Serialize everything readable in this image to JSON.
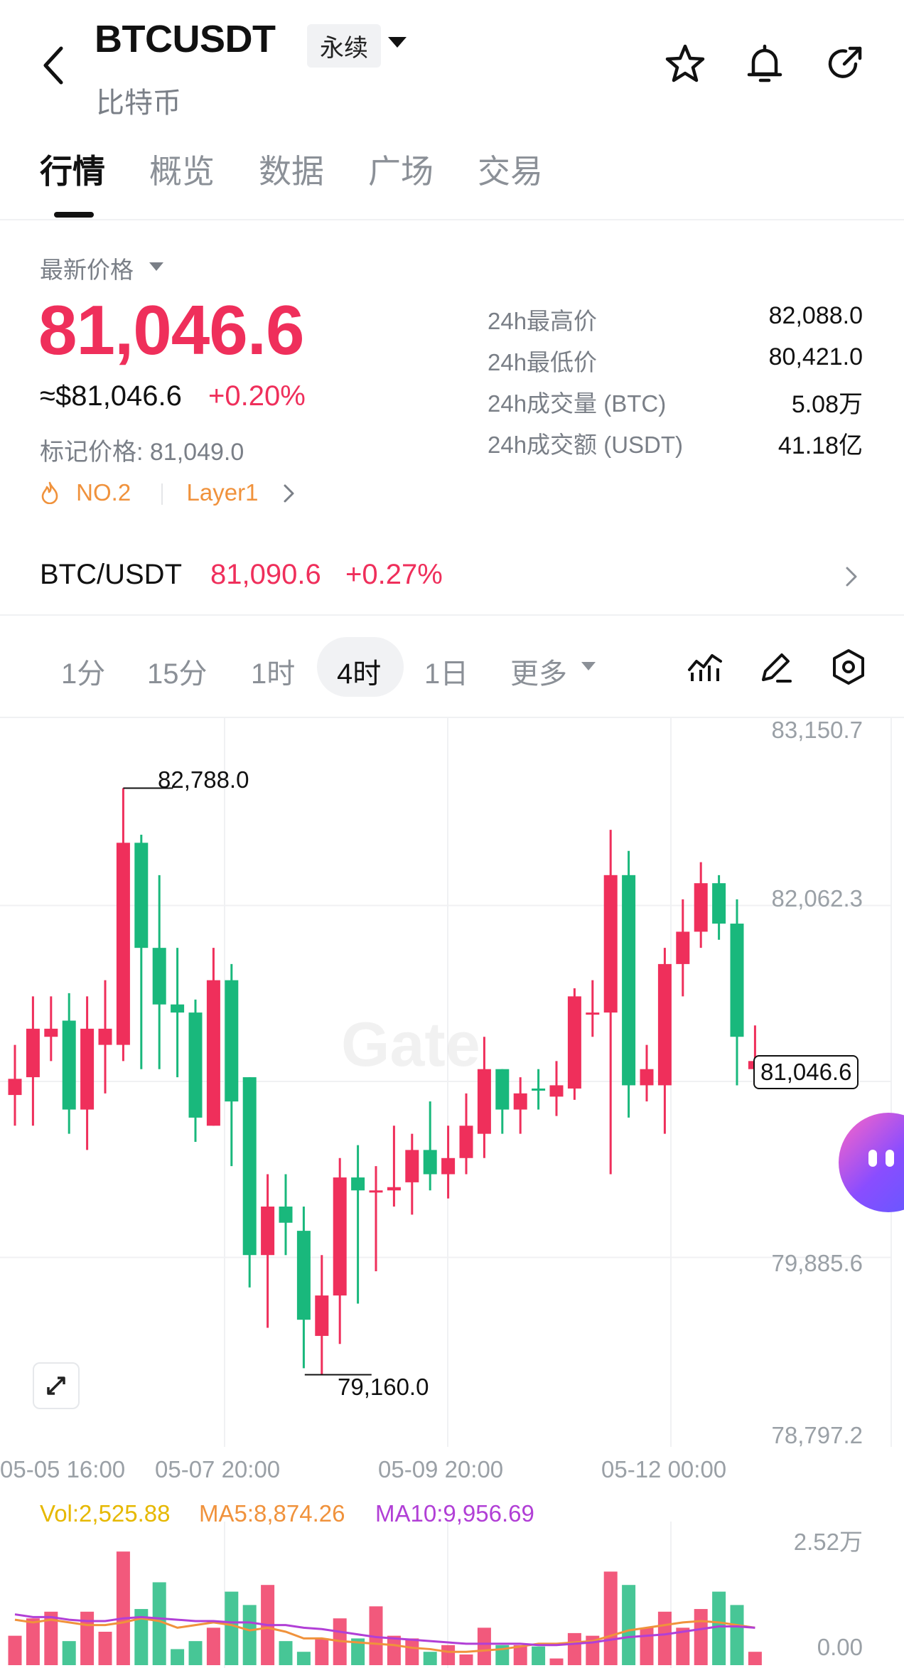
{
  "header": {
    "symbol": "BTCUSDT",
    "contract_type": "永续",
    "subtitle": "比特币"
  },
  "tabs": [
    "行情",
    "概览",
    "数据",
    "广场",
    "交易"
  ],
  "price": {
    "label": "最新价格",
    "last": "81,046.6",
    "usd": "≈$81,046.6",
    "change": "+0.20%",
    "mark": "标记价格: 81,049.0",
    "rank": "NO.2",
    "category": "Layer1"
  },
  "stats": [
    {
      "label": "24h最高价",
      "value": "82,088.0"
    },
    {
      "label": "24h最低价",
      "value": "80,421.0"
    },
    {
      "label": "24h成交量 (BTC)",
      "value": "5.08万"
    },
    {
      "label": "24h成交额 (USDT)",
      "value": "41.18亿"
    }
  ],
  "spot": {
    "pair": "BTC/USDT",
    "price": "81,090.6",
    "change": "+0.27%"
  },
  "timeframes": [
    "1分",
    "15分",
    "1时",
    "4时",
    "1日",
    "更多"
  ],
  "timeframe_active": "4时",
  "chart": {
    "y_axis": [
      "83,150.7",
      "82,062.3",
      "79,885.6",
      "78,797.2"
    ],
    "x_axis": [
      "05-05 16:00",
      "05-07 20:00",
      "05-09 20:00",
      "05-12 00:00"
    ],
    "high_label": "82,788.0",
    "low_label": "79,160.0",
    "current_price": "81,046.6",
    "watermark": "Gate",
    "colors": {
      "up": "#ef2f5b",
      "down": "#19b87c"
    }
  },
  "volume": {
    "vol": "Vol:2,525.88",
    "ma5": "MA5:8,874.26",
    "ma10": "MA10:9,956.69",
    "axis_top": "2.52万",
    "axis_bottom": "0.00",
    "colors": {
      "vol": "#e6b800",
      "ma5": "#f0923c",
      "ma10": "#b13fd6"
    }
  },
  "chart_data": {
    "type": "candlestick",
    "ylim": [
      78797.2,
      83150.7
    ],
    "candles": [
      [
        80890,
        80990,
        81200,
        80700,
        "up"
      ],
      [
        81000,
        81300,
        81500,
        80700,
        "up"
      ],
      [
        81300,
        81250,
        81500,
        81100,
        "up"
      ],
      [
        81350,
        80800,
        81520,
        80650,
        "down"
      ],
      [
        80800,
        81300,
        81500,
        80550,
        "up"
      ],
      [
        81300,
        81200,
        81600,
        80900,
        "up"
      ],
      [
        81200,
        82450,
        82788,
        81100,
        "up"
      ],
      [
        82450,
        81800,
        82500,
        81050,
        "down"
      ],
      [
        81800,
        81450,
        82250,
        81050,
        "down"
      ],
      [
        81450,
        81400,
        81800,
        81000,
        "down"
      ],
      [
        81400,
        80750,
        81480,
        80600,
        "down"
      ],
      [
        80700,
        81600,
        81800,
        80700,
        "up"
      ],
      [
        81600,
        80850,
        81700,
        80450,
        "down"
      ],
      [
        81000,
        79900,
        81000,
        79700,
        "down"
      ],
      [
        79900,
        80200,
        80400,
        79450,
        "up"
      ],
      [
        80200,
        80100,
        80400,
        79900,
        "down"
      ],
      [
        80050,
        79500,
        80200,
        79200,
        "down"
      ],
      [
        79400,
        79650,
        79900,
        79160,
        "up"
      ],
      [
        79650,
        80380,
        80500,
        79350,
        "up"
      ],
      [
        80380,
        80300,
        80580,
        79600,
        "down"
      ],
      [
        80290,
        80300,
        80450,
        79800,
        "up"
      ],
      [
        80300,
        80320,
        80700,
        80200,
        "up"
      ],
      [
        80350,
        80550,
        80650,
        80150,
        "up"
      ],
      [
        80550,
        80400,
        80850,
        80300,
        "down"
      ],
      [
        80400,
        80500,
        80700,
        80250,
        "up"
      ],
      [
        80500,
        80700,
        80900,
        80400,
        "up"
      ],
      [
        80650,
        81050,
        81250,
        80500,
        "up"
      ],
      [
        81050,
        80800,
        81050,
        80650,
        "down"
      ],
      [
        80800,
        80900,
        81000,
        80650,
        "up"
      ],
      [
        80930,
        80920,
        81050,
        80800,
        "down"
      ],
      [
        80880,
        80950,
        81100,
        80760,
        "up"
      ],
      [
        80930,
        81500,
        81550,
        80860,
        "up"
      ],
      [
        81400,
        81400,
        81600,
        81250,
        "up"
      ],
      [
        81400,
        82250,
        82530,
        80400,
        "up"
      ],
      [
        82250,
        80950,
        82400,
        80750,
        "down"
      ],
      [
        80950,
        81050,
        81200,
        80850,
        "up"
      ],
      [
        80950,
        81700,
        81800,
        80650,
        "up"
      ],
      [
        81700,
        81900,
        82100,
        81500,
        "up"
      ],
      [
        81900,
        82200,
        82330,
        81800,
        "up"
      ],
      [
        82200,
        81950,
        82250,
        81850,
        "down"
      ],
      [
        81950,
        81250,
        82100,
        80950,
        "down"
      ],
      [
        81050,
        81100,
        81320,
        80950,
        "up"
      ]
    ],
    "volume": [
      0.22,
      0.35,
      0.4,
      0.18,
      0.4,
      0.25,
      0.85,
      0.42,
      0.62,
      0.12,
      0.18,
      0.28,
      0.55,
      0.45,
      0.6,
      0.18,
      0.1,
      0.2,
      0.35,
      0.2,
      0.44,
      0.22,
      0.2,
      0.1,
      0.15,
      0.08,
      0.28,
      0.15,
      0.15,
      0.14,
      0.05,
      0.24,
      0.22,
      0.7,
      0.6,
      0.28,
      0.4,
      0.28,
      0.42,
      0.55,
      0.45,
      0.1
    ],
    "ma5": [
      0.34,
      0.32,
      0.34,
      0.32,
      0.3,
      0.3,
      0.32,
      0.35,
      0.33,
      0.28,
      0.3,
      0.32,
      0.3,
      0.26,
      0.28,
      0.25,
      0.2,
      0.2,
      0.18,
      0.17,
      0.16,
      0.15,
      0.13,
      0.12,
      0.1,
      0.1,
      0.11,
      0.12,
      0.14,
      0.16,
      0.16,
      0.17,
      0.18,
      0.22,
      0.26,
      0.28,
      0.3,
      0.32,
      0.33,
      0.32,
      0.3,
      0.28
    ],
    "ma10": [
      0.38,
      0.36,
      0.36,
      0.34,
      0.33,
      0.33,
      0.35,
      0.36,
      0.35,
      0.34,
      0.33,
      0.33,
      0.32,
      0.32,
      0.3,
      0.3,
      0.28,
      0.27,
      0.25,
      0.23,
      0.21,
      0.2,
      0.19,
      0.18,
      0.17,
      0.16,
      0.16,
      0.16,
      0.16,
      0.15,
      0.15,
      0.16,
      0.17,
      0.19,
      0.21,
      0.22,
      0.23,
      0.25,
      0.27,
      0.29,
      0.29,
      0.28
    ]
  }
}
